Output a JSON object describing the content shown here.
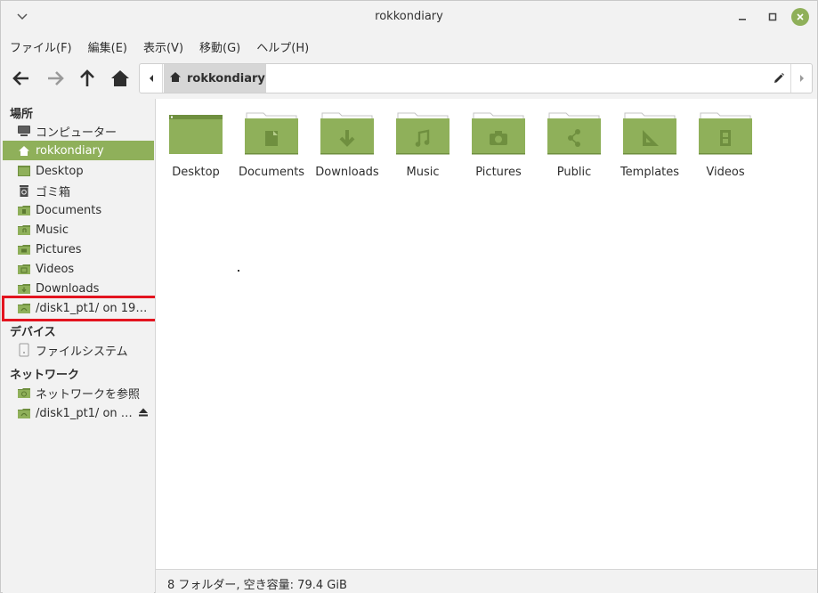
{
  "window": {
    "title": "rokkondiary"
  },
  "menubar": [
    "ファイル(F)",
    "編集(E)",
    "表示(V)",
    "移動(G)",
    "ヘルプ(H)"
  ],
  "pathbar": {
    "crumb": "rokkondiary"
  },
  "sidebar": {
    "sections": {
      "places": "場所",
      "devices": "デバイス",
      "network": "ネットワーク"
    },
    "places": [
      {
        "label": "コンピューター",
        "icon": "computer-icon"
      },
      {
        "label": "rokkondiary",
        "icon": "home-icon",
        "active": true
      },
      {
        "label": "Desktop",
        "icon": "desktop-folder-icon"
      },
      {
        "label": "ゴミ箱",
        "icon": "trash-icon"
      },
      {
        "label": "Documents",
        "icon": "documents-folder-icon"
      },
      {
        "label": "Music",
        "icon": "music-folder-icon"
      },
      {
        "label": "Pictures",
        "icon": "pictures-folder-icon"
      },
      {
        "label": "Videos",
        "icon": "videos-folder-icon"
      },
      {
        "label": "Downloads",
        "icon": "downloads-folder-icon"
      },
      {
        "label": "/disk1_pt1/ on 192…",
        "icon": "network-folder-icon"
      }
    ],
    "devices": [
      {
        "label": "ファイルシステム",
        "icon": "drive-icon"
      }
    ],
    "network": [
      {
        "label": "ネットワークを参照",
        "icon": "network-browse-icon"
      },
      {
        "label": "/disk1_pt1/ on …",
        "icon": "network-folder-icon"
      }
    ]
  },
  "files": [
    {
      "name": "Desktop",
      "emblem": "desktop"
    },
    {
      "name": "Documents",
      "emblem": "document"
    },
    {
      "name": "Downloads",
      "emblem": "download"
    },
    {
      "name": "Music",
      "emblem": "music"
    },
    {
      "name": "Pictures",
      "emblem": "camera"
    },
    {
      "name": "Public",
      "emblem": "share"
    },
    {
      "name": "Templates",
      "emblem": "triangle"
    },
    {
      "name": "Videos",
      "emblem": "film"
    }
  ],
  "status": "8 フォルダー, 空き容量: 79.4 GiB",
  "colors": {
    "accent": "#8fb05a",
    "folder": "#8fb05a",
    "folder_dark": "#6f8f3f",
    "highlight": "#e3141f"
  }
}
